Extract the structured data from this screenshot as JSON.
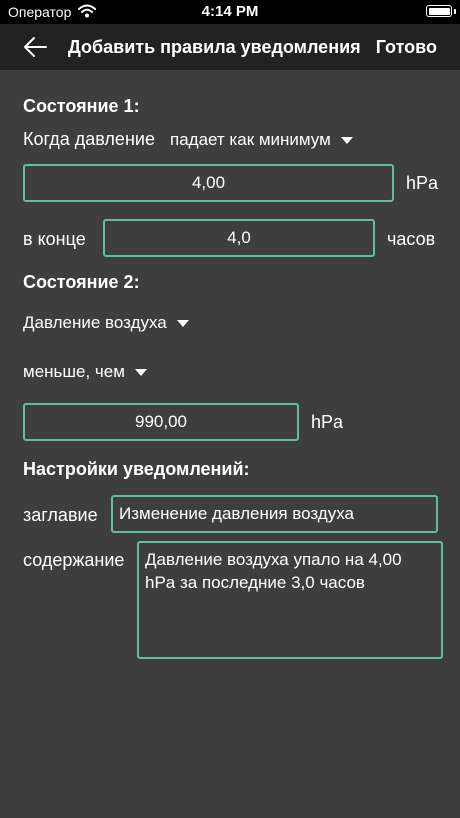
{
  "status_bar": {
    "carrier": "Оператор",
    "time": "4:14 PM"
  },
  "nav": {
    "title": "Добавить правила уведомления",
    "done_label": "Готово"
  },
  "condition1": {
    "title": "Состояние 1:",
    "when_label": "Когда давление",
    "mode_dropdown": "падает как минимум",
    "value": "4,00",
    "unit": "hPa",
    "at_end_label": "в конце",
    "hours_value": "4,0",
    "hours_unit": "часов"
  },
  "condition2": {
    "title": "Состояние 2:",
    "parameter_dropdown": "Давление воздуха",
    "comparison_dropdown": "меньше, чем",
    "value": "990,00",
    "unit": "hPa"
  },
  "notification": {
    "title": "Настройки уведомлений:",
    "title_label": "заглавие",
    "title_value": "Изменение давления воздуха",
    "content_label": "содержание",
    "content_value": "Давление воздуха упало на 4,00 hPa за последние 3,0 часов"
  }
}
